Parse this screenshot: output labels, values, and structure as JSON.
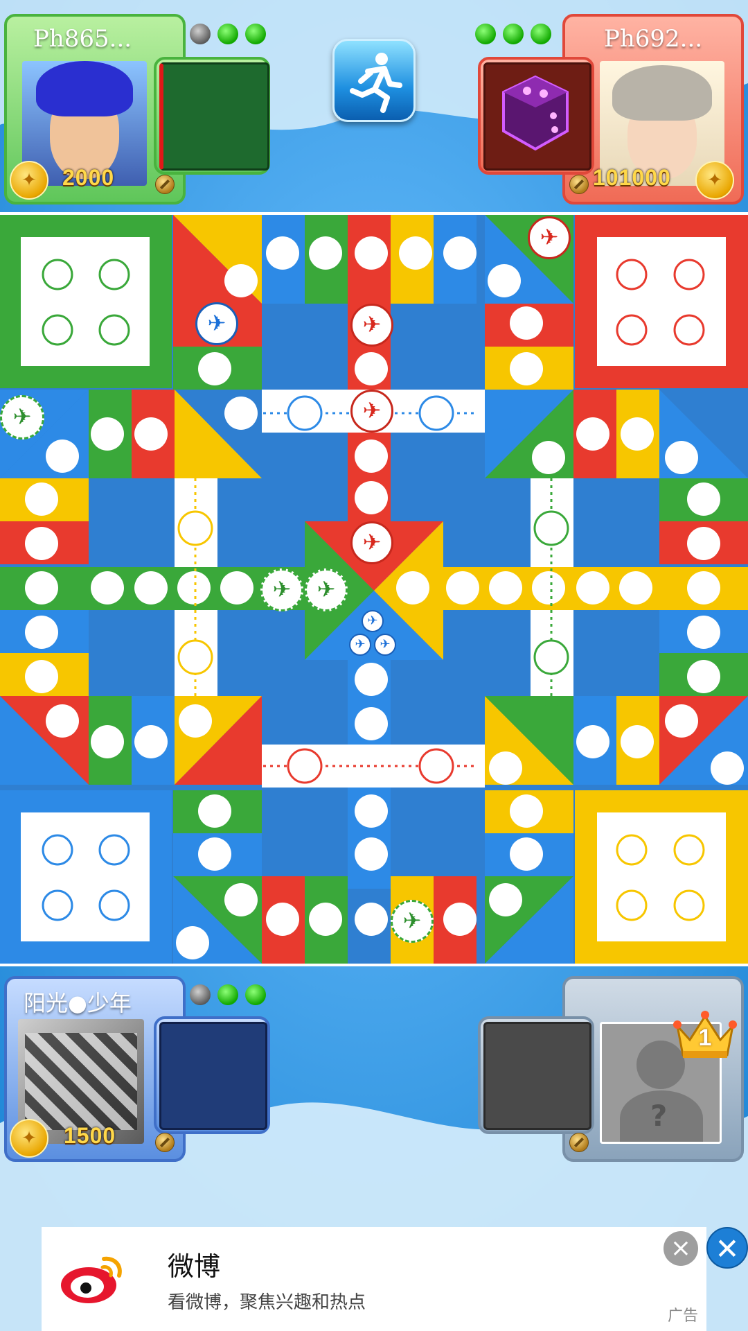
{
  "players": {
    "green": {
      "name": "Ph865...",
      "coins": "2000",
      "color": "#2fa02f"
    },
    "red": {
      "name": "Ph692...",
      "coins": "101000",
      "color": "#e83a2e"
    },
    "blue": {
      "name": "阳光●少年",
      "coins": "1500",
      "color": "#2d77d8"
    },
    "empty": {
      "rank_badge": "1"
    }
  },
  "ad": {
    "title": "微博",
    "subtitle": "看微博，聚焦兴趣和热点",
    "tag": "广告"
  },
  "icons": {
    "flee": "running-man-icon",
    "dice": "dice-icon",
    "ad_close": "close-icon",
    "weibo": "weibo-logo-icon"
  },
  "colors": {
    "green": "#2fa02f",
    "red": "#e83a2e",
    "yellow": "#f7c600",
    "blue": "#2d77d8",
    "board_bg": "#2f7fd1"
  }
}
